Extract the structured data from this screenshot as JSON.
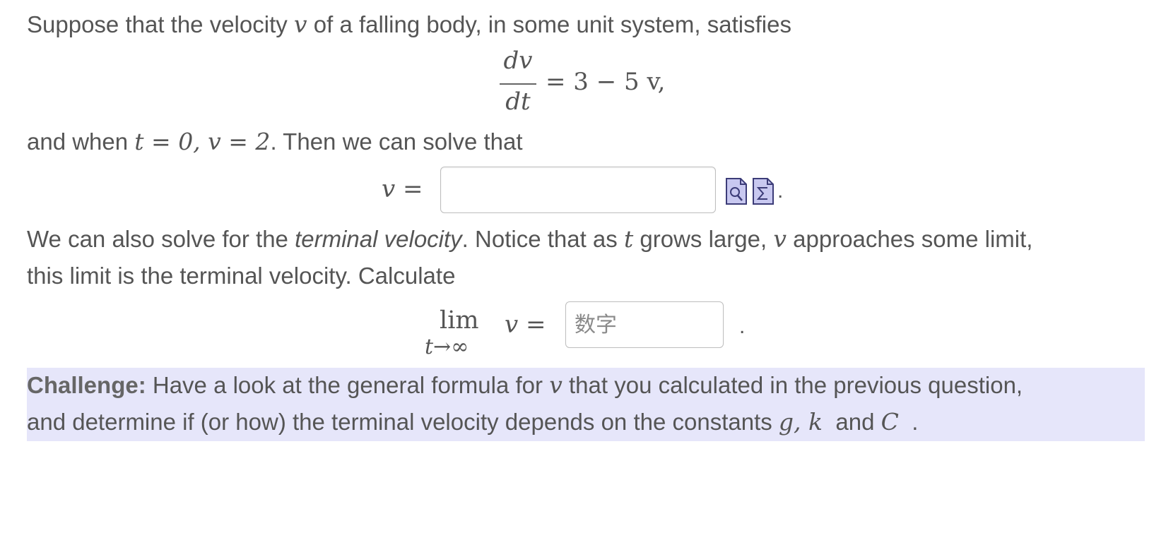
{
  "intro": {
    "text_before": "Suppose that the velocity",
    "v": "v",
    "text_after": "of a falling body, in some unit system, satisfies"
  },
  "equation": {
    "numerator": "dv",
    "denominator": "dt",
    "rhs": "= 3 − 5 v,"
  },
  "condition": {
    "text_before": "and when",
    "math": "t = 0, v = 2",
    "text_after": ". Then we can solve that"
  },
  "answer1": {
    "lhs": "v =",
    "value": "",
    "trailing": "."
  },
  "icons": {
    "preview": "preview-icon",
    "equation_editor": "sigma-icon"
  },
  "terminal": {
    "line1_a": "We can also solve for the",
    "line1_em": "terminal velocity",
    "line1_b": ". Notice that as",
    "t": "t",
    "line1_c": "grows large,",
    "v": "v",
    "line1_d": "approaches some limit,",
    "line2": "this limit is the terminal velocity. Calculate"
  },
  "limit": {
    "lim": "lim",
    "sub": "t→∞",
    "expr": "v =",
    "placeholder": "数字",
    "value": "",
    "trailing": "."
  },
  "challenge": {
    "label": "Challenge:",
    "line1_a": "Have a look at the general formula for",
    "v": "v",
    "line1_b": "that you calculated in the previous question,",
    "line2_a": "and determine if (or how) the terminal velocity depends on the constants",
    "gk": "g, k",
    "and": "and",
    "C": "C",
    "end": "."
  },
  "colors": {
    "text": "#555555",
    "challenge_bg": "#e6e6fa",
    "icon_fill": "#c8c8f0",
    "icon_stroke": "#3c3c78"
  }
}
